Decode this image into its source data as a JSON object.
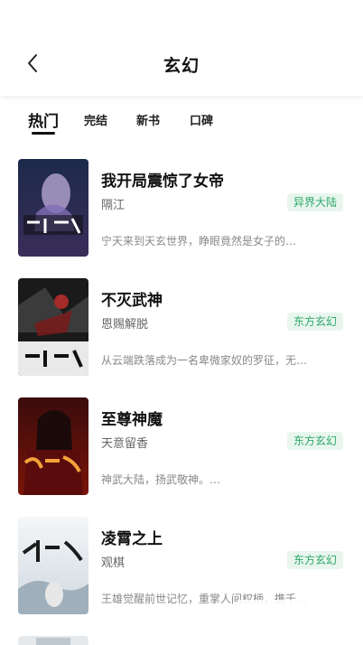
{
  "header": {
    "title": "玄幻"
  },
  "tabs": [
    {
      "label": "热门",
      "active": true
    },
    {
      "label": "完结",
      "active": false
    },
    {
      "label": "新书",
      "active": false
    },
    {
      "label": "口碑",
      "active": false
    }
  ],
  "books": [
    {
      "title": "我开局震惊了女帝",
      "author": "隔江",
      "category": "异界大陆",
      "desc": "宁天来到天玄世界，睁眼竟然是女子的…"
    },
    {
      "title": "不灭武神",
      "author": "恩赐解脱",
      "category": "东方玄幻",
      "desc": "从云端跌落成为一名卑微家奴的罗征，无…"
    },
    {
      "title": "至尊神魔",
      "author": "天意留香",
      "category": "东方玄幻",
      "desc": "神武大陆，扬武敬神。…"
    },
    {
      "title": "凌霄之上",
      "author": "观棋",
      "category": "东方玄幻",
      "desc": "王雄觉醒前世记忆，重掌人间权柄，携千…"
    }
  ],
  "colors": {
    "badge_bg": "#e8f6ee",
    "badge_text": "#2ea768"
  }
}
